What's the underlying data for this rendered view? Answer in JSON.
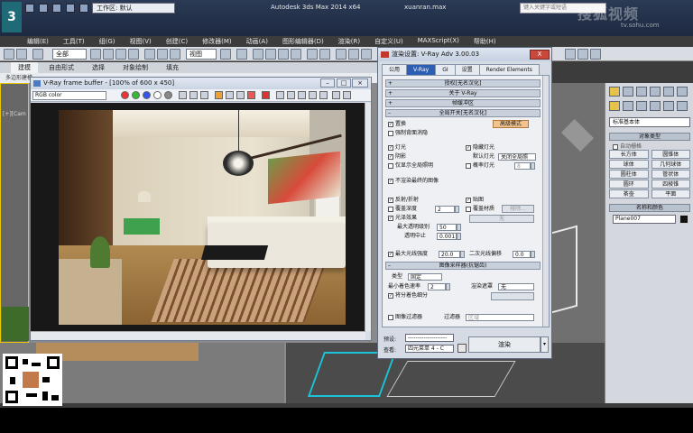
{
  "app": {
    "title": "Autodesk 3ds Max  2014 x64",
    "file": "xuanran.max",
    "workspace": "工作区: 默认",
    "search_placeholder": "键入关键字或短语",
    "watermark": "搜狐视频",
    "watermark_url": "tv.sohu.com",
    "logo": "3"
  },
  "menubar": [
    "编辑(E)",
    "工具(T)",
    "组(G)",
    "视图(V)",
    "创建(C)",
    "修改器(M)",
    "动画(A)",
    "图形编辑器(D)",
    "渲染(R)",
    "自定义(U)",
    "MAXScript(X)",
    "帮助(H)"
  ],
  "toolbar": {
    "selection_filter": "全部",
    "ref_coord": "视图"
  },
  "ribbon": {
    "tabs": [
      "建模",
      "自由形式",
      "选择",
      "对象绘制",
      "填充"
    ],
    "active_tab": 0,
    "strip_label": "多边形建模"
  },
  "viewport": {
    "left_label": "[+][Cam"
  },
  "frame_buffer": {
    "title": "V-Ray frame buffer - [100% of 600 x 450]",
    "channel": "RGB color"
  },
  "render_setup": {
    "title": "渲染设置: V-Ray Adv 3.00.03",
    "close_label": "X",
    "tabs": [
      "公用",
      "V-Ray",
      "GI",
      "设置",
      "Render Elements"
    ],
    "active_tab": 1,
    "rollouts": {
      "authorization": "授权[无名汉化]",
      "about": "关于 V-Ray",
      "frame_buffer": "帧缓冲区",
      "global_switches": "全局开关[无名汉化]",
      "image_sampler": "图像采样器(抗锯齿)"
    },
    "global": {
      "displacement": "置换",
      "mode_button": "高级模式",
      "force_backface": "强制背面消隐",
      "lights": "灯光",
      "hidden_lights": "隐藏灯光",
      "shadows": "阴影",
      "default_lights_label": "默认灯光",
      "default_lights_value": "关闭全局照",
      "gi_only": "仅显示全局照明",
      "probabilistic": "概率灯光",
      "probabilistic_value": "8",
      "dont_render_final": "不渲染最终的图像",
      "reflection": "反射/折射",
      "maps": "贴图",
      "override_depth": "覆盖深度",
      "override_depth_value": "2",
      "override_mtl": "覆盖材质",
      "exclude_btn": "排除...",
      "glossy": "光泽效果",
      "none_btn": "无",
      "max_transp_label": "最大透明级别",
      "max_transp_value": "50",
      "transp_cutoff_label": "透明中止",
      "transp_cutoff_value": "0.001",
      "max_ray_label": "最大光线强度",
      "max_ray_value": "20.0",
      "secondary_bias_label": "二次光线偏移",
      "secondary_bias_value": "0.0"
    },
    "sampler": {
      "type_label": "类型",
      "type_value": "固定",
      "render_mask_label": "渲染遮罩",
      "render_mask_value": "无",
      "min_shading_label": "最小着色速率",
      "min_shading_value": "2",
      "divide_shading": "将分着色细分",
      "image_filter": "图像过滤器",
      "filter_label": "过滤器",
      "filter_value": "区域"
    },
    "bottom": {
      "preset_label": "预设:",
      "preset_value": "--------------------",
      "view_label": "查看:",
      "view_value": "四元菜单 4 - C",
      "render_button": "渲染"
    }
  },
  "command_panel": {
    "dropdown": "标准基本体",
    "object_type_header": "对象类型",
    "autogrid": "自动栅格",
    "primitives": [
      "长方体",
      "圆锥体",
      "球体",
      "几何球体",
      "圆柱体",
      "管状体",
      "圆环",
      "四棱锥",
      "茶壶",
      "平面"
    ],
    "name_color_header": "名称和颜色",
    "object_name": "Plane007"
  }
}
